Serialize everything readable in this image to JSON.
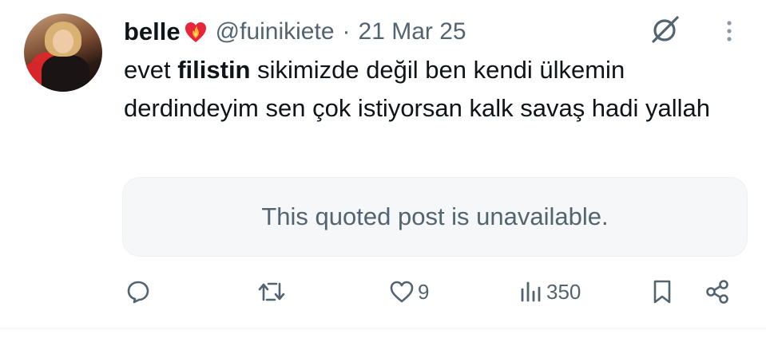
{
  "tweet": {
    "display_name": "belle",
    "handle": "@fuinikiete",
    "separator": "·",
    "date": "21 Mar 25",
    "text_part1": "evet ",
    "text_bold": "filistin",
    "text_part2": " sikimizde değil ben kendi ülkemin derdindeyim sen çok istiyorsan kalk savaş hadi yallah"
  },
  "quote": {
    "unavailable_text": "This quoted post is unavailable."
  },
  "actions": {
    "reply_count": "",
    "retweet_count": "",
    "like_count": "9",
    "views_count": "350"
  },
  "icons": {
    "heart_emoji": "heart-on-fire-icon",
    "header_right": "grok-icon",
    "menu": "more-vertical-icon"
  },
  "colors": {
    "text_primary": "#0f1419",
    "text_secondary": "#536471",
    "quote_bg": "#f5f7f8"
  }
}
